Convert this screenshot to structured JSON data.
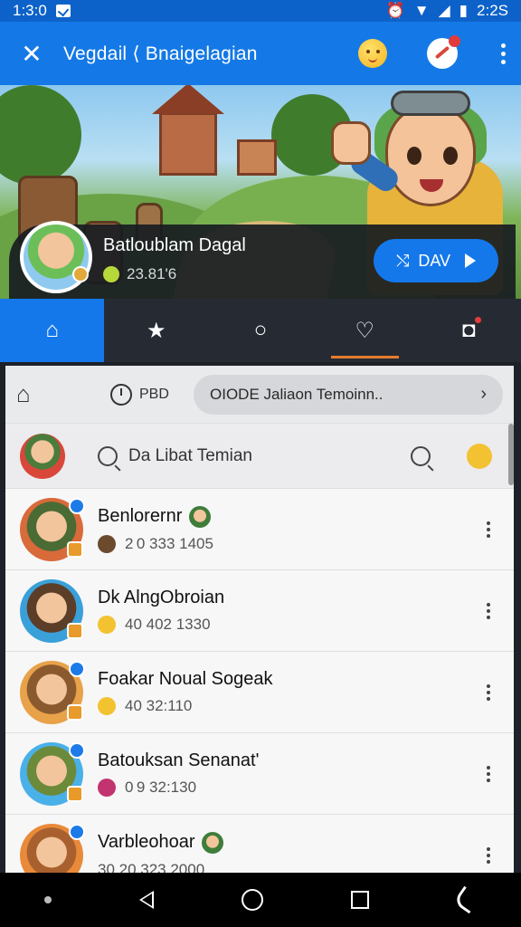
{
  "status_bar": {
    "time_left": "1:3:0",
    "time_right": "2:2S"
  },
  "app_bar": {
    "title": "Vegdail ⟨ Bnaigelagian"
  },
  "profile": {
    "name": "Batloublam Dagal",
    "count": "23.81'6",
    "action_label": "DAV"
  },
  "tabs": [
    {
      "icon": "home-icon"
    },
    {
      "icon": "star-icon"
    },
    {
      "icon": "search-icon"
    },
    {
      "icon": "heart-icon"
    },
    {
      "icon": "camera-icon"
    }
  ],
  "filter": {
    "label": "PBD",
    "dropdown": "OIODE Jaliaon Temoinn..",
    "chevron": "›"
  },
  "search": {
    "placeholder": "Da Libat Temian"
  },
  "list": [
    {
      "name": "Benlorernr",
      "detail": "2 0 333 1405",
      "icon_color": "#6b4a2e"
    },
    {
      "name": "Dk AlngObroian",
      "detail": "40 402 1330",
      "icon_color": "#f2c230"
    },
    {
      "name": "Foakar Noual Sogeak",
      "detail": "40 32:110",
      "icon_color": "#f2c230"
    },
    {
      "name": "Batouksan Senanat'",
      "detail": "0 9 32:130",
      "icon_color": "#c2346f"
    },
    {
      "name": "Varbleohoar",
      "detail": "30 20 323 2000",
      "icon_color": "#777777"
    }
  ],
  "colors": {
    "accent": "#1479e6",
    "tab_bg": "#262b33",
    "heart_underline": "#e67c2e"
  }
}
